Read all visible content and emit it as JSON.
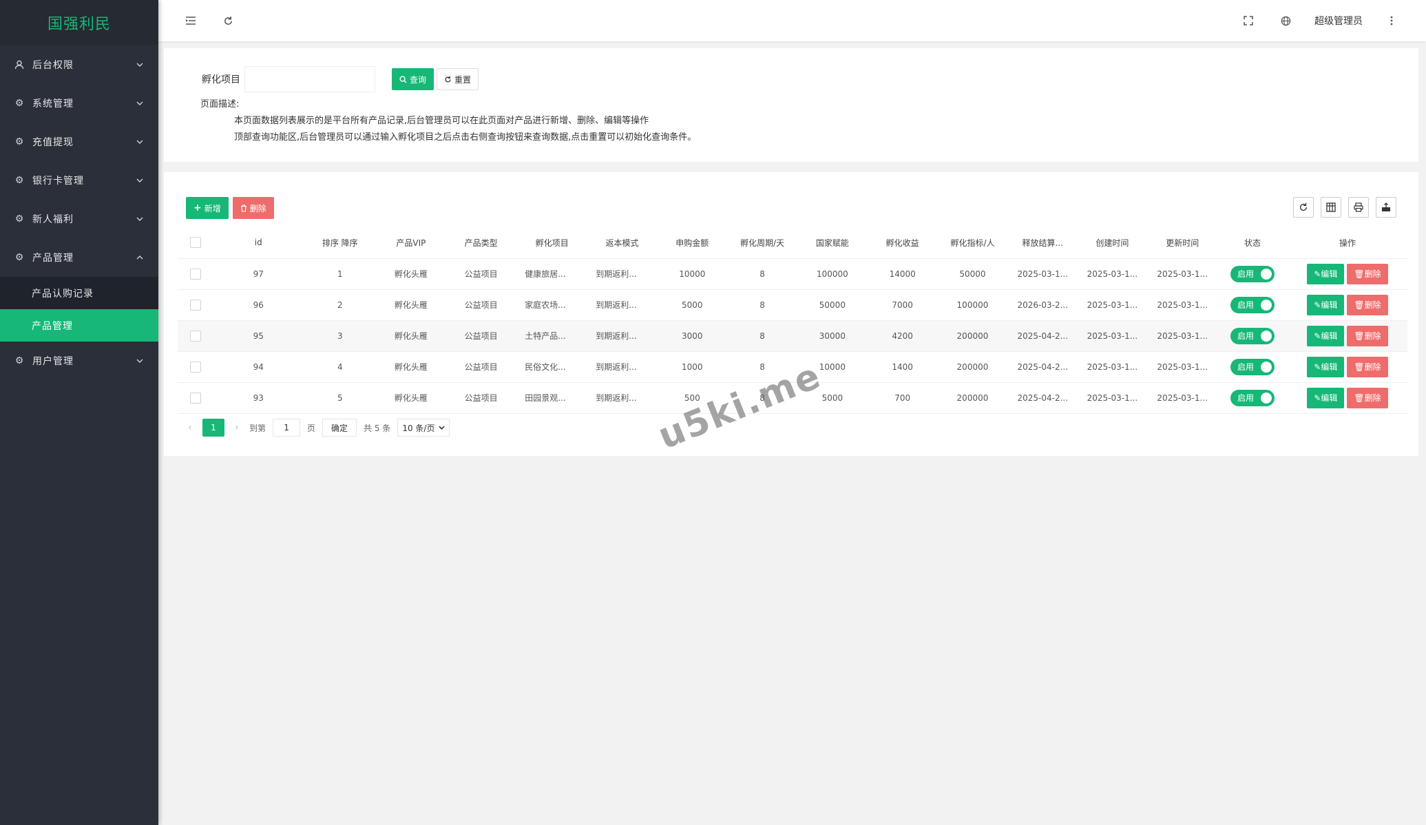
{
  "app": {
    "logo": "国强利民",
    "watermark": "u5ki.me"
  },
  "header": {
    "user": "超级管理员",
    "icons": [
      "menu-fold-icon",
      "refresh-icon",
      "fullscreen-icon",
      "globe-icon",
      "more-vertical-icon"
    ]
  },
  "sidebar": {
    "items": [
      {
        "label": "后台权限",
        "icon": "user-icon"
      },
      {
        "label": "系统管理",
        "icon": "gear-icon"
      },
      {
        "label": "充值提现",
        "icon": "gear-icon"
      },
      {
        "label": "银行卡管理",
        "icon": "gear-icon"
      },
      {
        "label": "新人福利",
        "icon": "gear-icon"
      },
      {
        "label": "产品管理",
        "icon": "gear-icon",
        "expanded": true
      },
      {
        "label": "用户管理",
        "icon": "gear-icon"
      }
    ],
    "sub_items": [
      "产品认购记录",
      "产品管理"
    ],
    "active_sub": "产品管理"
  },
  "search": {
    "label": "孵化项目",
    "value": "",
    "query_label": "查询",
    "reset_label": "重置",
    "desc_title": "页面描述:",
    "desc_lines": [
      "本页面数据列表展示的是平台所有产品记录,后台管理员可以在此页面对产品进行新增、删除、编辑等操作",
      "顶部查询功能区,后台管理员可以通过输入孵化项目之后点击右侧查询按钮来查询数据,点击重置可以初始化查询条件。"
    ]
  },
  "toolbar": {
    "add_label": "新增",
    "delete_label": "删除",
    "right_icons": [
      "refresh-icon",
      "columns-icon",
      "print-icon",
      "export-icon"
    ]
  },
  "table": {
    "columns": [
      "id",
      "排序 降序",
      "产品VIP",
      "产品类型",
      "孵化项目",
      "返本模式",
      "申购金额",
      "孵化周期/天",
      "国家赋能",
      "孵化收益",
      "孵化指标/人",
      "释放结算...",
      "创建时间",
      "更新时间",
      "状态",
      "操作"
    ],
    "rows": [
      {
        "id": "97",
        "sort": "1",
        "vip": "孵化头雁",
        "type": "公益项目",
        "project": "健康旅居...",
        "mode": "到期返利...",
        "amount": "10000",
        "cycle": "8",
        "empower": "100000",
        "income": "14000",
        "quota": "50000",
        "settle": "2025-03-1...",
        "created": "2025-03-1...",
        "updated": "2025-03-1..."
      },
      {
        "id": "96",
        "sort": "2",
        "vip": "孵化头雁",
        "type": "公益项目",
        "project": "家庭农场...",
        "mode": "到期返利...",
        "amount": "5000",
        "cycle": "8",
        "empower": "50000",
        "income": "7000",
        "quota": "100000",
        "settle": "2026-03-2...",
        "created": "2025-03-1...",
        "updated": "2025-03-1..."
      },
      {
        "id": "95",
        "sort": "3",
        "vip": "孵化头雁",
        "type": "公益项目",
        "project": "土特产品...",
        "mode": "到期返利...",
        "amount": "3000",
        "cycle": "8",
        "empower": "30000",
        "income": "4200",
        "quota": "200000",
        "settle": "2025-04-2...",
        "created": "2025-03-1...",
        "updated": "2025-03-1..."
      },
      {
        "id": "94",
        "sort": "4",
        "vip": "孵化头雁",
        "type": "公益项目",
        "project": "民俗文化...",
        "mode": "到期返利...",
        "amount": "1000",
        "cycle": "8",
        "empower": "10000",
        "income": "1400",
        "quota": "200000",
        "settle": "2025-04-2...",
        "created": "2025-03-1...",
        "updated": "2025-03-1..."
      },
      {
        "id": "93",
        "sort": "5",
        "vip": "孵化头雁",
        "type": "公益项目",
        "project": "田园景观...",
        "mode": "到期返利...",
        "amount": "500",
        "cycle": "8",
        "empower": "5000",
        "income": "700",
        "quota": "200000",
        "settle": "2025-04-2...",
        "created": "2025-03-1...",
        "updated": "2025-03-1..."
      }
    ],
    "status_label": "启用",
    "edit_label": "编辑",
    "delete_label": "删除"
  },
  "pagination": {
    "current": "1",
    "goto_label": "到第",
    "goto_value": "1",
    "page_label": "页",
    "confirm_label": "确定",
    "total_label": "共 5 条",
    "page_size": "10 条/页"
  }
}
